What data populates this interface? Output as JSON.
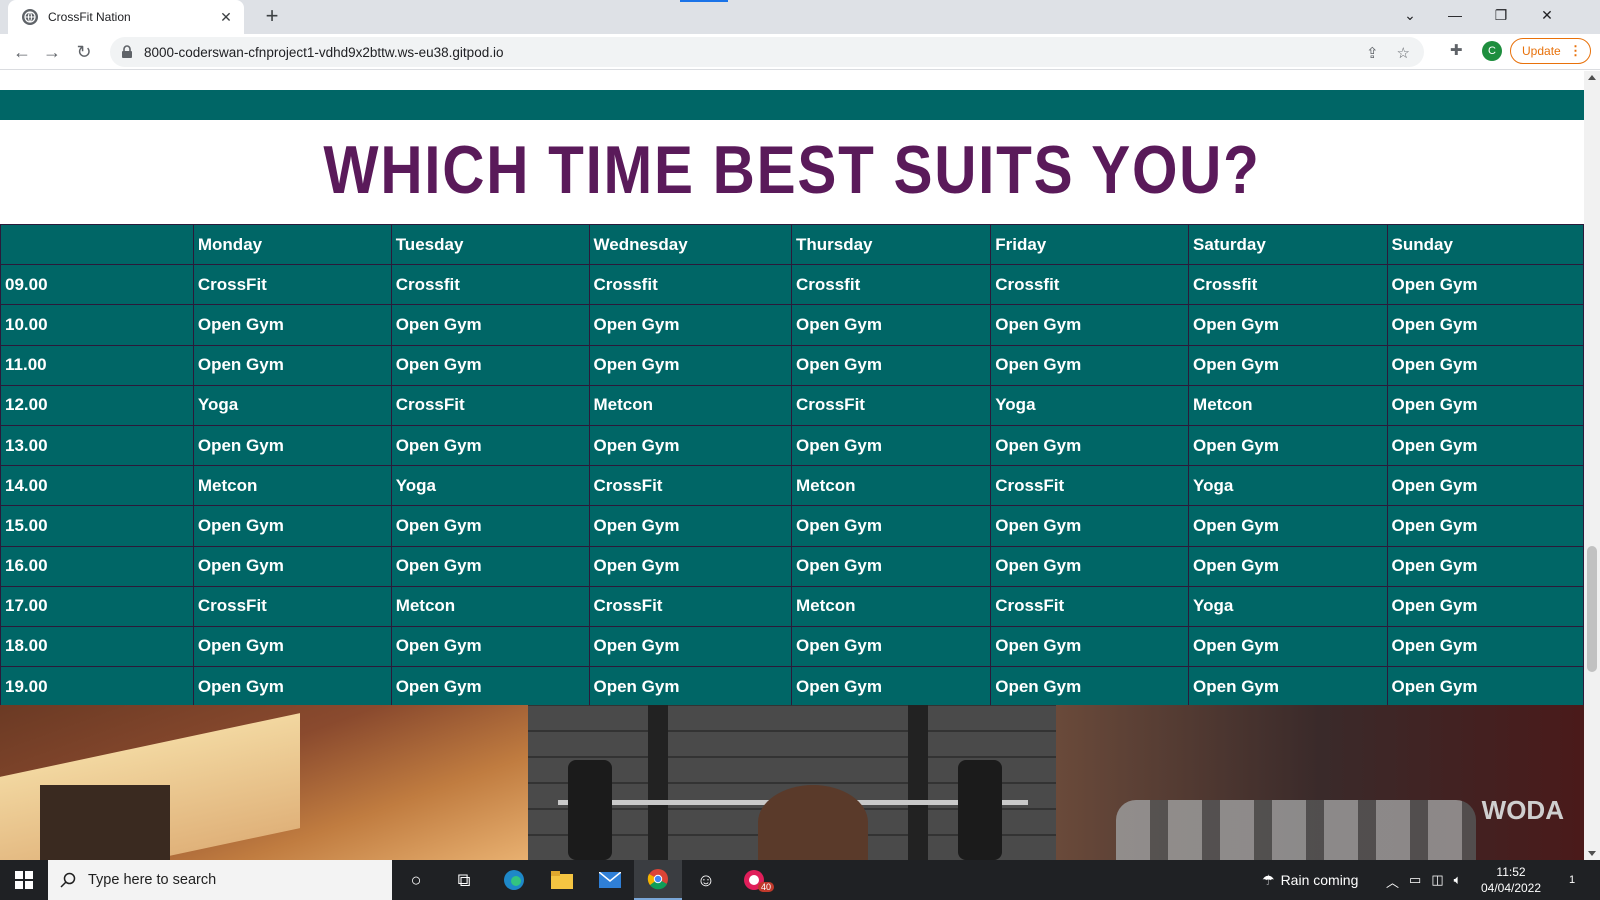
{
  "browser": {
    "tab_title": "CrossFit Nation",
    "url": "8000-coderswan-cfnproject1-vdhd9x2bttw.ws-eu38.gitpod.io",
    "update_label": "Update",
    "avatar_letter": "C"
  },
  "page": {
    "heading": "WHICH TIME BEST SUITS YOU?",
    "colors": {
      "teal": "#006666",
      "heading_purple": "#5a1a5a"
    },
    "schedule": {
      "days": [
        "Monday",
        "Tuesday",
        "Wednesday",
        "Thursday",
        "Friday",
        "Saturday",
        "Sunday"
      ],
      "rows": [
        {
          "time": "09.00",
          "cells": [
            "CrossFit",
            "Crossfit",
            "Crossfit",
            "Crossfit",
            "Crossfit",
            "Crossfit",
            "Open Gym"
          ]
        },
        {
          "time": "10.00",
          "cells": [
            "Open Gym",
            "Open Gym",
            "Open Gym",
            "Open Gym",
            "Open Gym",
            "Open Gym",
            "Open Gym"
          ]
        },
        {
          "time": "11.00",
          "cells": [
            "Open Gym",
            "Open Gym",
            "Open Gym",
            "Open Gym",
            "Open Gym",
            "Open Gym",
            "Open Gym"
          ]
        },
        {
          "time": "12.00",
          "cells": [
            "Yoga",
            "CrossFit",
            "Metcon",
            "CrossFit",
            "Yoga",
            "Metcon",
            "Open Gym"
          ]
        },
        {
          "time": "13.00",
          "cells": [
            "Open Gym",
            "Open Gym",
            "Open Gym",
            "Open Gym",
            "Open Gym",
            "Open Gym",
            "Open Gym"
          ]
        },
        {
          "time": "14.00",
          "cells": [
            "Metcon",
            "Yoga",
            "CrossFit",
            "Metcon",
            "CrossFit",
            "Yoga",
            "Open Gym"
          ]
        },
        {
          "time": "15.00",
          "cells": [
            "Open Gym",
            "Open Gym",
            "Open Gym",
            "Open Gym",
            "Open Gym",
            "Open Gym",
            "Open Gym"
          ]
        },
        {
          "time": "16.00",
          "cells": [
            "Open Gym",
            "Open Gym",
            "Open Gym",
            "Open Gym",
            "Open Gym",
            "Open Gym",
            "Open Gym"
          ]
        },
        {
          "time": "17.00",
          "cells": [
            "CrossFit",
            "Metcon",
            "CrossFit",
            "Metcon",
            "CrossFit",
            "Yoga",
            "Open Gym"
          ]
        },
        {
          "time": "18.00",
          "cells": [
            "Open Gym",
            "Open Gym",
            "Open Gym",
            "Open Gym",
            "Open Gym",
            "Open Gym",
            "Open Gym"
          ]
        },
        {
          "time": "19.00",
          "cells": [
            "Open Gym",
            "Open Gym",
            "Open Gym",
            "Open Gym",
            "Open Gym",
            "Open Gym",
            "Open Gym"
          ]
        }
      ]
    },
    "photo_logo_text": "WODA"
  },
  "taskbar": {
    "search_placeholder": "Type here to search",
    "weather": "Rain coming",
    "time": "11:52",
    "date": "04/04/2022",
    "slack_badge": "40",
    "notification_count": "1"
  }
}
